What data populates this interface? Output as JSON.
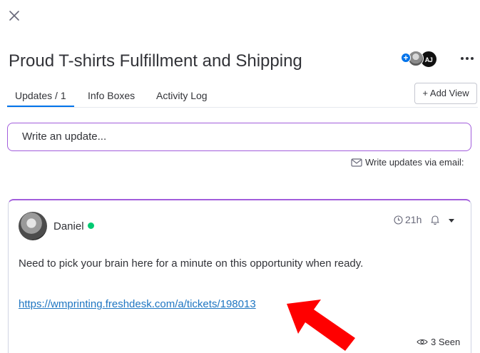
{
  "header": {
    "title": "Proud T-shirts Fulfillment and Shipping",
    "avatar_logo_text": "AJ"
  },
  "tabs": [
    {
      "label": "Updates / 1",
      "active": true
    },
    {
      "label": "Info Boxes",
      "active": false
    },
    {
      "label": "Activity Log",
      "active": false
    }
  ],
  "add_view_label": "+ Add View",
  "update_input": {
    "placeholder": "Write an update..."
  },
  "email_updates_label": "Write updates via email:",
  "post": {
    "author": "Daniel",
    "author_status": "online",
    "time": "21h",
    "body": "Need to pick your brain here for a minute on this opportunity when ready.",
    "link": "https://wmprinting.freshdesk.com/a/tickets/198013",
    "seen": "3 Seen"
  },
  "colors": {
    "accent_purple": "#a25ddc",
    "tab_underline_blue": "#0073ea",
    "link_blue": "#1f76c2",
    "online_green": "#00ca72",
    "annotation_red": "#ff0000"
  },
  "icons": [
    "close-icon",
    "plus-icon",
    "more-dots-icon",
    "mail-icon",
    "clock-icon",
    "bell-icon",
    "caret-down-icon",
    "eye-icon",
    "red-arrow-annotation"
  ]
}
